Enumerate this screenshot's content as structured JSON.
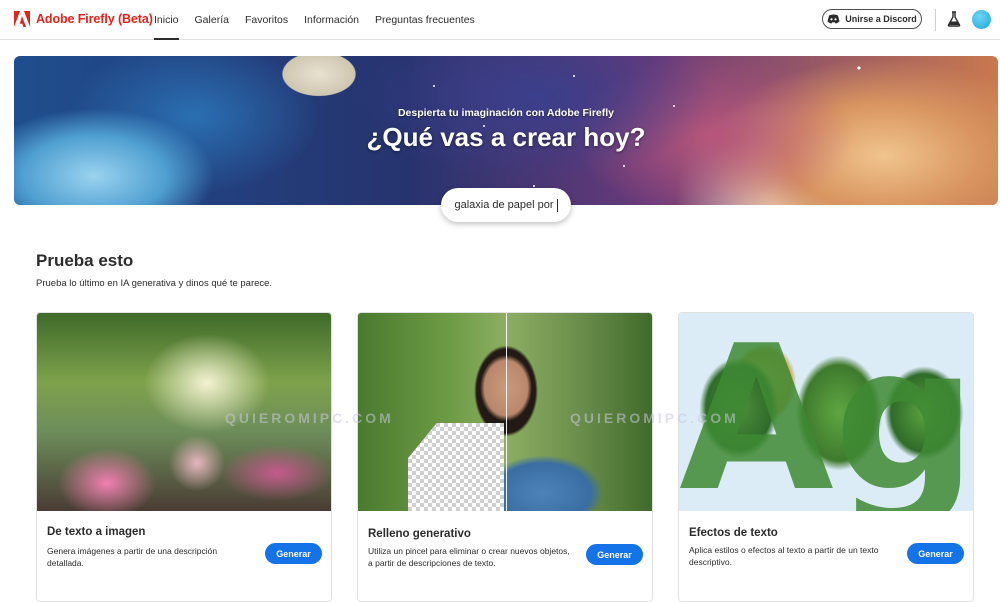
{
  "header": {
    "logo_text": "Adobe Firefly (Beta)",
    "nav": [
      {
        "label": "Inicio",
        "active": true
      },
      {
        "label": "Galería",
        "active": false
      },
      {
        "label": "Favoritos",
        "active": false
      },
      {
        "label": "Información",
        "active": false
      },
      {
        "label": "Preguntas frecuentes",
        "active": false
      }
    ],
    "discord_label": "Unirse a Discord"
  },
  "hero": {
    "subtitle": "Despierta tu imaginación con Adobe Firefly",
    "title": "¿Qué vas a crear hoy?",
    "prompt_value": "galaxia de papel por"
  },
  "section": {
    "title": "Prueba esto",
    "subtitle": "Prueba lo último en IA generativa y dinos qué te parece."
  },
  "cards": [
    {
      "title": "De texto a imagen",
      "description": "Genera imágenes a partir de una descripción detallada.",
      "button": "Generar"
    },
    {
      "title": "Relleno generativo",
      "description": "Utiliza un pincel para eliminar o crear nuevos objetos, a partir de descripciones de texto.",
      "button": "Generar"
    },
    {
      "title": "Efectos de texto",
      "description": "Aplica estilos o efectos al texto a partir de un texto descriptivo.",
      "button": "Generar"
    }
  ],
  "watermarks": [
    "QUIEROMIPC.COM",
    "QUIEROMIPC.COM"
  ],
  "colors": {
    "brand_red": "#e1251b",
    "accent_blue": "#1473e6"
  }
}
